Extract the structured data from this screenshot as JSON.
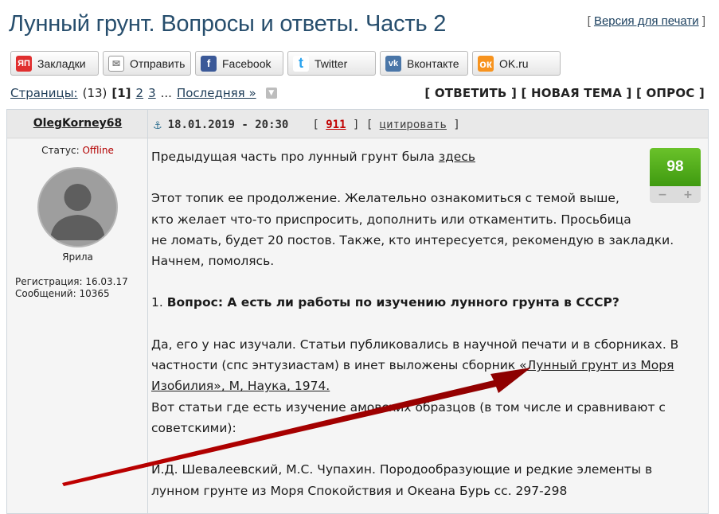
{
  "page": {
    "title": "Лунный грунт. Вопросы и ответы. Часть 2",
    "print_link": "Версия для печати",
    "print_bracket_left": "[",
    "print_bracket_right": "]"
  },
  "share": [
    {
      "icon": "yandex-icon",
      "icon_text": "ЯП",
      "label": "Закладки"
    },
    {
      "icon": "mail-icon",
      "icon_text": "✉",
      "label": "Отправить"
    },
    {
      "icon": "facebook-icon",
      "icon_text": "f",
      "label": "Facebook"
    },
    {
      "icon": "twitter-icon",
      "icon_text": "t",
      "label": "Twitter"
    },
    {
      "icon": "vk-icon",
      "icon_text": "vk",
      "label": "Вконтакте"
    },
    {
      "icon": "ok-icon",
      "icon_text": "ок",
      "label": "OK.ru"
    }
  ],
  "pager": {
    "label": "Страницы:",
    "count": "(13)",
    "current": "[1]",
    "pages": [
      "2",
      "3"
    ],
    "ellipsis": "...",
    "last": "Последняя »",
    "actions": "[ ОТВЕТИТЬ ] [ НОВАЯ ТЕМА ] [ ОПРОС ]"
  },
  "post": {
    "author": "OlegKorney68",
    "status_label": "Статус:",
    "status_value": "Offline",
    "rank": "Ярила",
    "registration": "Регистрация: 16.03.17",
    "messages": "Сообщений: 10365",
    "datetime": "18.01.2019 - 20:30",
    "number": "911",
    "cite": "цитировать",
    "rating": "98",
    "minus": "−",
    "plus": "+",
    "body": {
      "p1_text": "Предыдущая часть про лунный грунт была ",
      "p1_link": "здесь",
      "p2_l1": "Этот топик ее продолжение. Желательно ознакомиться с темой выше,",
      "p2_l2": "кто желает что-то приспросить, дополнить или откаментить. Просьбица",
      "p2_l3": "не ломать, будет 20 постов. Также, кто интересуется, рекомендую в закладки.",
      "p2_l4": "Начнем, помолясь.",
      "q_num": "1. ",
      "q_text": "Вопрос: А есть ли работы по изучению лунного грунта в СССР?",
      "a_l1": "Да, его у нас изучали. Статьи публиковались в научной печати и в сборниках. В",
      "a_l2": "частности (спс энтузиастам) в инет выложены сборник ",
      "a_link1": "«Лунный грунт из Моря",
      "a_link2": "Изобилия», М, Наука, 1974.",
      "a_l4": "Вот статьи где есть изучение амовских образцов (в том числе и сравнивают с",
      "a_l5": "советскими):",
      "ref_l1": "И.Д. Шевалеевский, М.С. Чупахин. Породообразующие и редкие элементы в",
      "ref_l2": "лунном грунте из Моря Спокойствия и Океана Бурь сс. 297-298"
    }
  },
  "colors": {
    "title": "#274e6d",
    "offline": "#b30000",
    "post_number": "#c10000",
    "rating_green": "#4fa81a",
    "arrow": "#b00000"
  }
}
